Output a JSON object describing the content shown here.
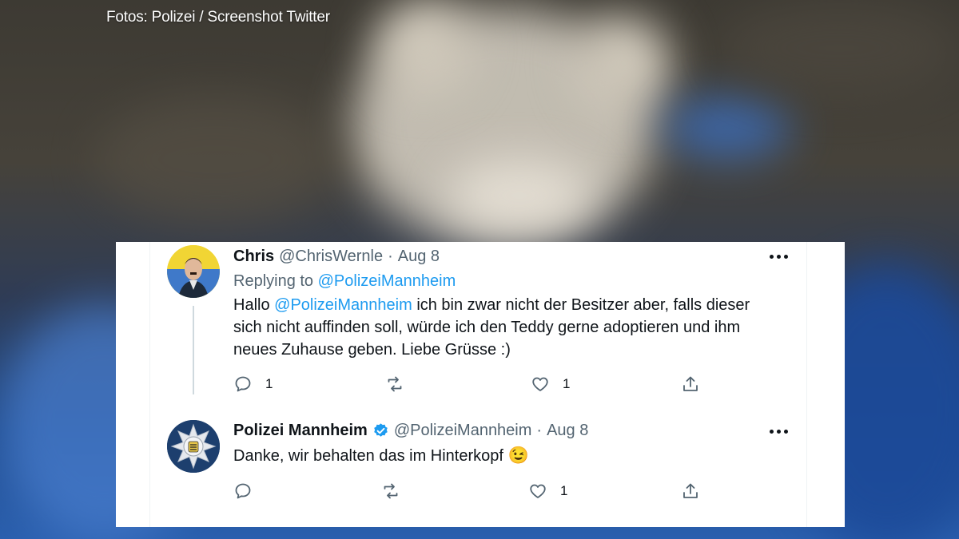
{
  "photo_credit": "Fotos: Polizei / Screenshot Twitter",
  "tweet1": {
    "name": "Chris",
    "handle": "@ChrisWernle",
    "separator": "·",
    "date": "Aug 8",
    "replying_prefix": "Replying to",
    "replying_to": "@PolizeiMannheim",
    "text_mention": "@PolizeiMannheim",
    "text_before": "Hallo",
    "text_line1_rest": "ich bin zwar nicht der Besitzer aber, falls dieser",
    "text_line2": "sich nicht auffinden soll, würde ich den Teddy gerne adoptieren und ihm",
    "text_line3": "neues Zuhause geben. Liebe Grüsse :)",
    "reply_count": "1",
    "like_count": "1"
  },
  "tweet2": {
    "name": "Polizei Mannheim",
    "handle": "@PolizeiMannheim",
    "separator": "·",
    "date": "Aug 8",
    "text": "Danke, wir behalten das im Hinterkopf",
    "emoji": "😉",
    "like_count": "1"
  },
  "colors": {
    "link": "#1d9bf0",
    "verified": "#1d9bf0",
    "secondary_text": "#536471"
  }
}
